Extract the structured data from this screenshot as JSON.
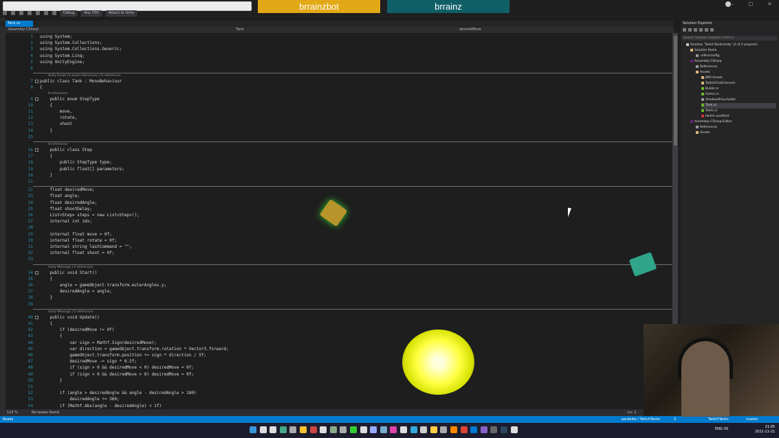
{
  "topbar": {
    "stream_buttons": [
      "brrainzbot",
      "brrainz"
    ],
    "toolbar": {
      "config": "Debug",
      "platform": "Any CPU",
      "attach": "Attach to Unity"
    }
  },
  "tabs": {
    "active": "Tank.cs"
  },
  "navbar": {
    "project": "Assembly-CSharp",
    "class": "Tank",
    "member": "desiredMove"
  },
  "editor": {
    "lines": [
      {
        "n": "1",
        "t": "using System;"
      },
      {
        "n": "2",
        "t": "using System.Collections;"
      },
      {
        "n": "3",
        "t": "using System.Collections.Generic;"
      },
      {
        "n": "4",
        "t": "using System.Linq;"
      },
      {
        "n": "5",
        "t": "using UnityEngine;"
      },
      {
        "n": "6",
        "t": ""
      },
      {
        "n": "7",
        "t": "public class Tank : MonoBehaviour"
      },
      {
        "n": "8",
        "t": "{"
      },
      {
        "n": "9",
        "t": "    public enum StepType"
      },
      {
        "n": "10",
        "t": "    {"
      },
      {
        "n": "11",
        "t": "        move,"
      },
      {
        "n": "12",
        "t": "        rotate,"
      },
      {
        "n": "13",
        "t": "        shoot"
      },
      {
        "n": "14",
        "t": "    }"
      },
      {
        "n": "15",
        "t": ""
      },
      {
        "n": "16",
        "t": "    public class Step"
      },
      {
        "n": "17",
        "t": "    {"
      },
      {
        "n": "18",
        "t": "        public StepType type;"
      },
      {
        "n": "19",
        "t": "        public float[] parameters;"
      },
      {
        "n": "20",
        "t": "    }"
      },
      {
        "n": "21",
        "t": ""
      },
      {
        "n": "22",
        "t": "    float desiredMove;"
      },
      {
        "n": "23",
        "t": "    float angle;"
      },
      {
        "n": "24",
        "t": "    float desiredAngle;"
      },
      {
        "n": "25",
        "t": "    float shootDelay;"
      },
      {
        "n": "26",
        "t": "    List<Step> steps = new List<Step>();"
      },
      {
        "n": "27",
        "t": "    internal int idx;"
      },
      {
        "n": "28",
        "t": ""
      },
      {
        "n": "29",
        "t": "    internal float move = 0f;"
      },
      {
        "n": "30",
        "t": "    internal float rotate = 0f;"
      },
      {
        "n": "31",
        "t": "    internal string lastCommand = \"\";"
      },
      {
        "n": "32",
        "t": "    internal float shoot = 0f;"
      },
      {
        "n": "33",
        "t": ""
      },
      {
        "n": "34",
        "t": "    public void Start()"
      },
      {
        "n": "35",
        "t": "    {"
      },
      {
        "n": "36",
        "t": "        angle = gameObject.transform.eulerAngles.y;"
      },
      {
        "n": "37",
        "t": "        desiredAngle = angle;"
      },
      {
        "n": "38",
        "t": "    }"
      },
      {
        "n": "39",
        "t": ""
      },
      {
        "n": "40",
        "t": "    public void Update()"
      },
      {
        "n": "41",
        "t": "    {"
      },
      {
        "n": "42",
        "t": "        if (desiredMove != 0f)"
      },
      {
        "n": "43",
        "t": "        {"
      },
      {
        "n": "44",
        "t": "            var sign = Mathf.Sign(desiredMove);"
      },
      {
        "n": "45",
        "t": "            var direction = gameObject.transform.rotation * Vector3.forward;"
      },
      {
        "n": "46",
        "t": "            gameObject.transform.position += sign * direction / 5f;"
      },
      {
        "n": "47",
        "t": "            desiredMove -= sign * 0.5f;"
      },
      {
        "n": "48",
        "t": "            if (sign > 0 && desiredMove < 0) desiredMove = 0f;"
      },
      {
        "n": "49",
        "t": "            if (sign < 0 && desiredMove > 0) desiredMove = 0f;"
      },
      {
        "n": "50",
        "t": "        }"
      },
      {
        "n": "51",
        "t": ""
      },
      {
        "n": "52",
        "t": "        if (angle > desiredAngle && angle - desiredAngle > 180)"
      },
      {
        "n": "53",
        "t": "            desiredAngle += 360;"
      },
      {
        "n": "54",
        "t": "        if (Mathf.Abs(angle - desiredAngle) < 1f)"
      },
      {
        "n": "55",
        "t": "            angle = desiredAngle;"
      }
    ],
    "lens": [
      "Unity Script (4 asset references) | 8 references",
      "8 references",
      "8 references",
      "Unity Message | 0 references",
      "Unity Message | 0 references"
    ]
  },
  "solution_explorer": {
    "title": "Solution Explorer",
    "search_placeholder": "Search Solution Explorer (Ctrl+;)",
    "items": [
      "Solution 'TwitchTanksUnity' (2 of 2 projects)",
      "Solution Items",
      ".editorconfig",
      "Assembly-CSharp",
      "References",
      "Assets",
      "JMO Assets",
      "TwitchChatConnect",
      "Bullet.cs",
      "Game.cs",
      "ShadowOnly.shader",
      "Tank.cs",
      "Tools.cs",
      "twitch.oauthtxt",
      "Assembly-CSharp-Editor",
      "References",
      "Assets"
    ]
  },
  "status": {
    "zoom": "122 %",
    "issues": "No issues found",
    "position": "Ln: 1",
    "ready": "Ready",
    "repo": "pardeike / TwitchTanks",
    "branch_count": "0",
    "project": "TwitchTanks",
    "branch": "master"
  },
  "taskbar": {
    "lang": "ENG",
    "region": "US",
    "time": "21:05",
    "date": "2021-11-21"
  }
}
